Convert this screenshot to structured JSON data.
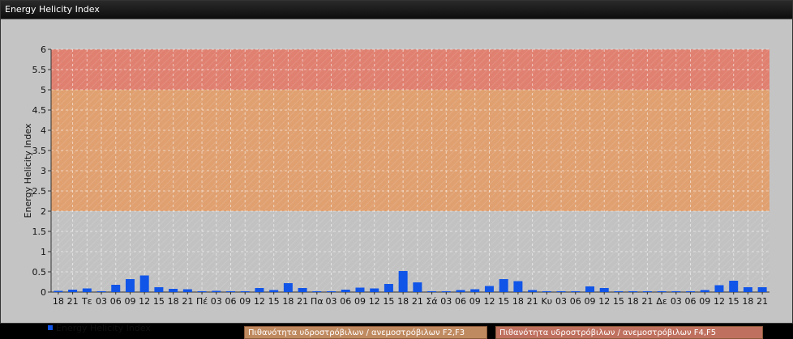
{
  "window": {
    "title": "Energy Helicity Index"
  },
  "chart_data": {
    "type": "bar",
    "ylabel": "Energy Helicity Index",
    "ylim": [
      0,
      6
    ],
    "yticks": [
      "0",
      "0.5",
      "1",
      "1.5",
      "2",
      "2.5",
      "3",
      "3.5",
      "4",
      "4.5",
      "5",
      "5.5",
      "6"
    ],
    "categories": [
      "18",
      "21",
      "Τε",
      "03",
      "06",
      "09",
      "12",
      "15",
      "18",
      "21",
      "Πέ",
      "03",
      "06",
      "09",
      "12",
      "15",
      "18",
      "21",
      "Πα",
      "03",
      "06",
      "09",
      "12",
      "15",
      "18",
      "21",
      "Σά",
      "03",
      "06",
      "09",
      "12",
      "15",
      "18",
      "21",
      "Κυ",
      "03",
      "06",
      "09",
      "12",
      "15",
      "18",
      "21",
      "Δε",
      "03",
      "06",
      "09",
      "12",
      "15",
      "18",
      "21"
    ],
    "series": [
      {
        "name": "Energy Helicity Index",
        "color": "#1054e8",
        "values": [
          0.03,
          0.06,
          0.09,
          0.02,
          0.18,
          0.32,
          0.41,
          0.12,
          0.08,
          0.07,
          0.02,
          0.03,
          0.02,
          0.02,
          0.1,
          0.05,
          0.22,
          0.1,
          0.02,
          0.02,
          0.06,
          0.11,
          0.09,
          0.2,
          0.52,
          0.24,
          0.02,
          0.02,
          0.05,
          0.07,
          0.15,
          0.32,
          0.27,
          0.05,
          0.02,
          0.02,
          0.02,
          0.14,
          0.1,
          0.02,
          0.02,
          0.02,
          0.02,
          0.02,
          0.02,
          0.05,
          0.17,
          0.28,
          0.12,
          0.12
        ]
      }
    ],
    "bands": [
      {
        "from": 2,
        "to": 5,
        "color": "#e0a070",
        "label": "Πιθανότητα υδροστρόβιλων / ανεμοστρόβιλων F2,F3"
      },
      {
        "from": 5,
        "to": 6,
        "color": "#e08070",
        "label": "Πιθανότητα υδροστρόβιλων / ανεμοστρόβιλων F4,F5"
      }
    ],
    "grid": true,
    "legend": "bottom-left"
  }
}
